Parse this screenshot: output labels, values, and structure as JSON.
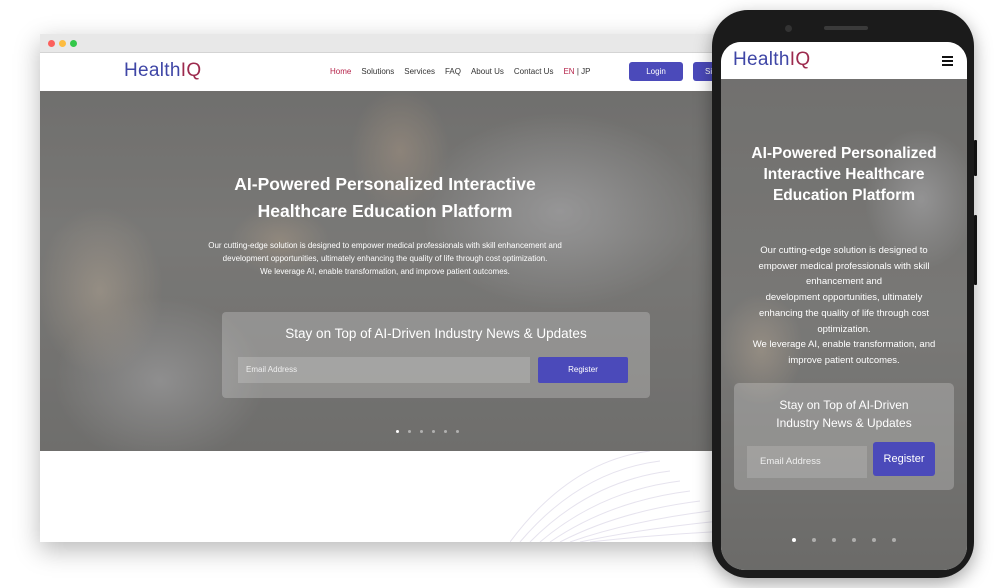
{
  "brand": {
    "logo_prefix": "Health",
    "logo_suffix": "IQ",
    "accent": "#4b4aba",
    "highlight": "#b5234a"
  },
  "nav": {
    "items": [
      {
        "label": "Home",
        "active": true
      },
      {
        "label": "Solutions"
      },
      {
        "label": "Services"
      },
      {
        "label": "FAQ"
      },
      {
        "label": "About Us"
      },
      {
        "label": "Contact Us"
      }
    ],
    "lang_en": "EN",
    "lang_sep": "|",
    "lang_jp": "JP",
    "login_label": "Login",
    "signup_label": "Si"
  },
  "hero": {
    "title_line1": "AI-Powered Personalized Interactive",
    "title_line2": "Healthcare Education Platform",
    "desc_line1": "Our cutting-edge solution is designed to empower medical professionals with skill enhancement and",
    "desc_line2": "development opportunities, ultimately enhancing the quality of life through cost optimization.",
    "desc_line3": "We leverage AI, enable transformation, and improve patient outcomes.",
    "news_heading": "Stay on Top of AI-Driven Industry News & Updates",
    "email_placeholder": "Email Address",
    "register_label": "Register",
    "slides_total": 6,
    "slide_active": 1
  },
  "mobile": {
    "title_line1": "AI-Powered Personalized",
    "title_line2": "Interactive Healthcare",
    "title_line3": "Education Platform",
    "desc_lines": [
      "Our cutting-edge solution is designed to",
      "empower medical professionals with skill",
      "enhancement and",
      "development opportunities, ultimately",
      "enhancing the quality of life through cost",
      "optimization.",
      "We leverage AI, enable transformation, and",
      "improve patient outcomes."
    ],
    "news_line1": "Stay on Top of AI-Driven",
    "news_line2": "Industry News & Updates",
    "email_placeholder": "Email Address",
    "register_label": "Register"
  }
}
